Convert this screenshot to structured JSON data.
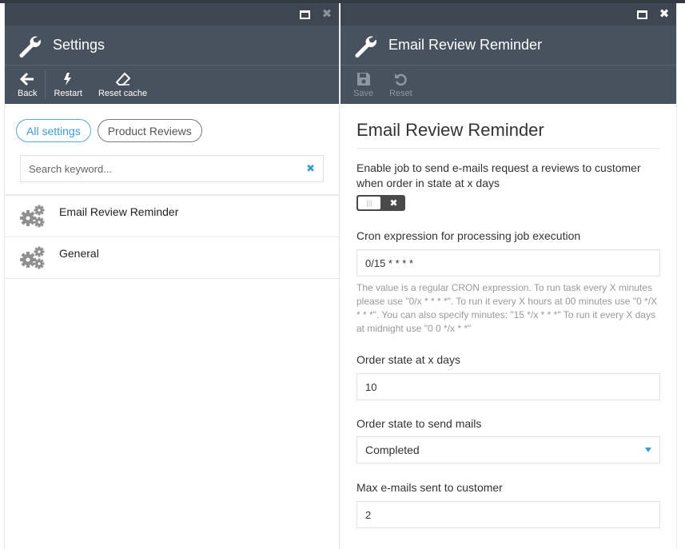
{
  "left_panel": {
    "title": "Settings",
    "toolbar": {
      "back_label": "Back",
      "restart_label": "Restart",
      "reset_cache_label": "Reset cache"
    },
    "filters": [
      {
        "label": "All settings",
        "active": true
      },
      {
        "label": "Product Reviews",
        "active": false
      }
    ],
    "search": {
      "placeholder": "Search keyword...",
      "value": ""
    },
    "items": [
      {
        "label": "Email Review Reminder"
      },
      {
        "label": "General"
      }
    ]
  },
  "right_panel": {
    "title": "Email Review Reminder",
    "toolbar": {
      "save_label": "Save",
      "reset_label": "Reset"
    },
    "form": {
      "heading": "Email Review Reminder",
      "enable_job": {
        "label": "Enable job to send e-mails request a reviews to customer when order in state at x days",
        "enabled": false
      },
      "cron": {
        "label": "Cron expression for processing job execution",
        "value": "0/15 * * * *",
        "help": "The value is a regular CRON expression. To run task every X minutes please use \"0/x * * * *\". To run it every X hours at 00 minutes use \"0 */X * * *\". You can also specify minutes: \"15 */x * * *\" To run it every X days at midnight use \"0 0 */x * *\""
      },
      "order_state_days": {
        "label": "Order state at x days",
        "value": "10"
      },
      "order_state_send": {
        "label": "Order state to send mails",
        "value": "Completed"
      },
      "max_emails": {
        "label": "Max e-mails sent to customer",
        "value": "2"
      }
    }
  },
  "colors": {
    "header_dark": "#3d4651",
    "header": "#48525e",
    "accent": "#3d9bd3"
  }
}
